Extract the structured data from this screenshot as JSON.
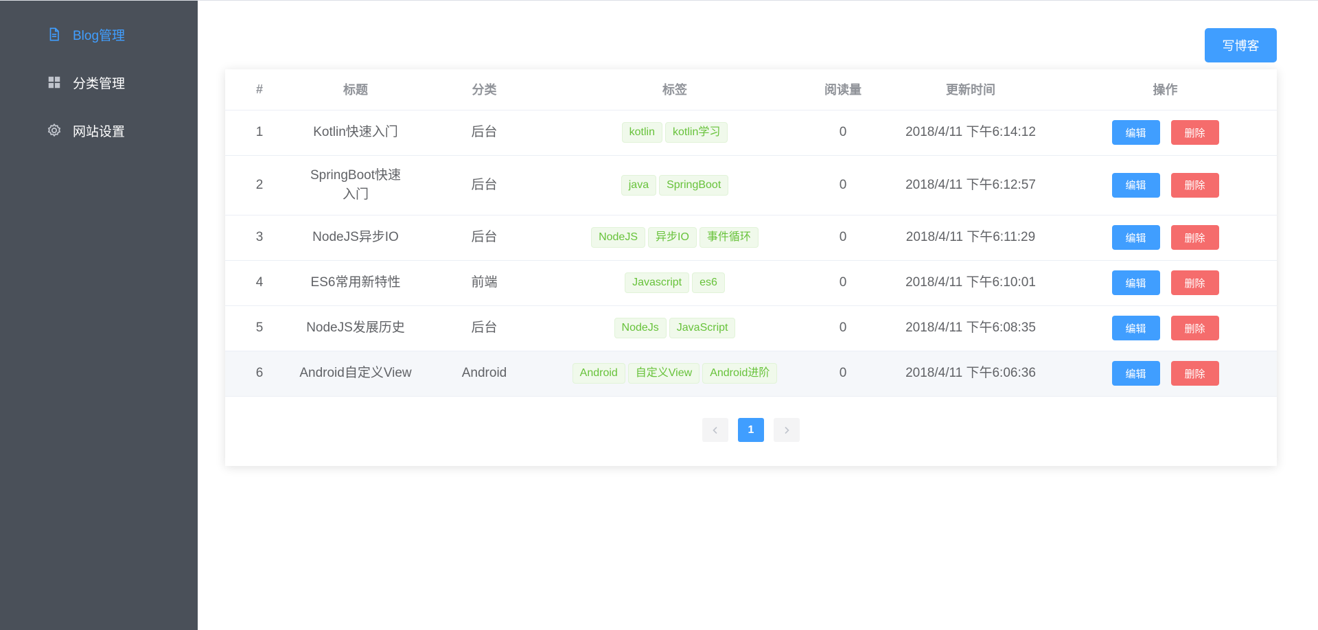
{
  "sidebar": {
    "items": [
      {
        "label": "Blog管理",
        "icon": "document-icon",
        "active": true
      },
      {
        "label": "分类管理",
        "icon": "grid-icon",
        "active": false
      },
      {
        "label": "网站设置",
        "icon": "gear-icon",
        "active": false
      }
    ]
  },
  "header": {
    "write_label": "写博客"
  },
  "table": {
    "columns": [
      "#",
      "标题",
      "分类",
      "标签",
      "阅读量",
      "更新时间",
      "操作"
    ],
    "edit_label": "编辑",
    "delete_label": "删除",
    "rows": [
      {
        "idx": "1",
        "title": "Kotlin快速入门",
        "category": "后台",
        "tags": [
          "kotlin",
          "kotlin学习"
        ],
        "reads": "0",
        "updated": "2018/4/11 下午6:14:12"
      },
      {
        "idx": "2",
        "title": "SpringBoot快速入门",
        "category": "后台",
        "tags": [
          "java",
          "SpringBoot"
        ],
        "reads": "0",
        "updated": "2018/4/11 下午6:12:57"
      },
      {
        "idx": "3",
        "title": "NodeJS异步IO",
        "category": "后台",
        "tags": [
          "NodeJS",
          "异步IO",
          "事件循环"
        ],
        "reads": "0",
        "updated": "2018/4/11 下午6:11:29"
      },
      {
        "idx": "4",
        "title": "ES6常用新特性",
        "category": "前端",
        "tags": [
          "Javascript",
          "es6"
        ],
        "reads": "0",
        "updated": "2018/4/11 下午6:10:01"
      },
      {
        "idx": "5",
        "title": "NodeJS发展历史",
        "category": "后台",
        "tags": [
          "NodeJs",
          "JavaScript"
        ],
        "reads": "0",
        "updated": "2018/4/11 下午6:08:35"
      },
      {
        "idx": "6",
        "title": "Android自定义View",
        "category": "Android",
        "tags": [
          "Android",
          "自定义View",
          "Android进阶"
        ],
        "reads": "0",
        "updated": "2018/4/11 下午6:06:36"
      }
    ]
  },
  "pagination": {
    "current_page": "1"
  },
  "colors": {
    "primary": "#409eff",
    "danger": "#f56c6c",
    "success": "#67c23a",
    "sidebar_bg": "#4a5059"
  }
}
